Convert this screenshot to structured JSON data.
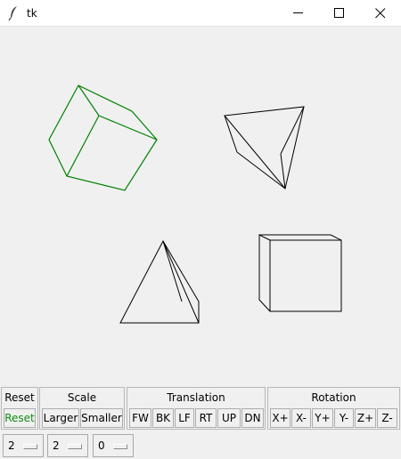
{
  "window": {
    "title": "tk",
    "icon": "feather-icon",
    "controls": [
      "minimize-icon",
      "maximize-icon",
      "close-icon"
    ]
  },
  "canvas": {
    "highlight_color": "#008000",
    "default_color": "#000000"
  },
  "panels": {
    "reset": {
      "title": "Reset",
      "button": "Reset",
      "button_color": "#138a13"
    },
    "scale": {
      "title": "Scale",
      "buttons": [
        "Larger",
        "Smaller"
      ]
    },
    "translation": {
      "title": "Translation",
      "buttons": [
        "FW",
        "BK",
        "LF",
        "RT",
        "UP",
        "DN"
      ]
    },
    "rotation": {
      "title": "Rotation",
      "buttons": [
        "X+",
        "X-",
        "Y+",
        "Y-",
        "Z+",
        "Z-"
      ]
    }
  },
  "options": [
    {
      "value": "2"
    },
    {
      "value": "2"
    },
    {
      "value": "0"
    }
  ]
}
